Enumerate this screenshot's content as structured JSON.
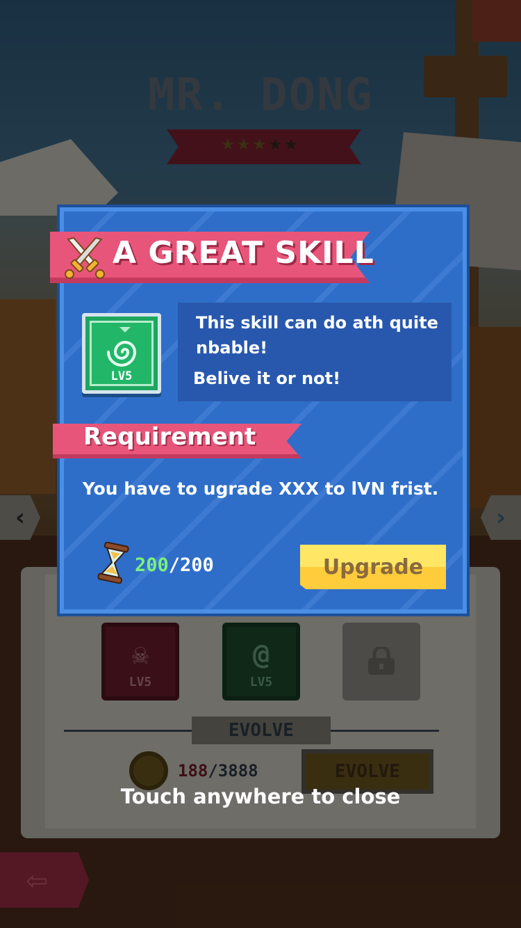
{
  "background": {
    "character_name": "MR. DONG",
    "stars_filled": 3,
    "stars_total": 5,
    "skill_slots": [
      {
        "kind": "skull",
        "level_label": "LV5",
        "color": "#6a1c2a"
      },
      {
        "kind": "spiral",
        "level_label": "LV5",
        "color": "#1c4a2c"
      },
      {
        "kind": "locked",
        "level_label": "",
        "color": "#8c8981"
      }
    ],
    "evolve": {
      "section_title": "EVOLVE",
      "coins_have": "188",
      "coins_need": "/3888",
      "button_label": "EVOLVE"
    }
  },
  "dialog": {
    "title": "A GREAT SKILL",
    "skill_icon_label": "LV5",
    "description_line1": "This skill  can do ath quite",
    "description_line2": "nbable!",
    "description_line3": "Belive it or not!",
    "requirement_title": "Requirement",
    "requirement_text": "You have to ugrade XXX to lVN frist.",
    "cost_have": "200",
    "cost_need": "/200",
    "upgrade_label": "Upgrade"
  },
  "close_hint": "Touch anywhere to close",
  "colors": {
    "dialog_blue": "#2f6ec8",
    "ribbon_pink": "#e8557a",
    "upgrade_yellow": "#ffcc3b",
    "cost_green": "#7cf07c",
    "skill_green": "#1ea65e"
  },
  "icons": [
    "crossed-swords-icon",
    "spiral-skill-icon",
    "hourglass-icon",
    "skull-icon",
    "lock-icon",
    "coin-icon",
    "back-arrow-icon",
    "chevron-left-icon",
    "chevron-right-icon",
    "star-icon"
  ]
}
